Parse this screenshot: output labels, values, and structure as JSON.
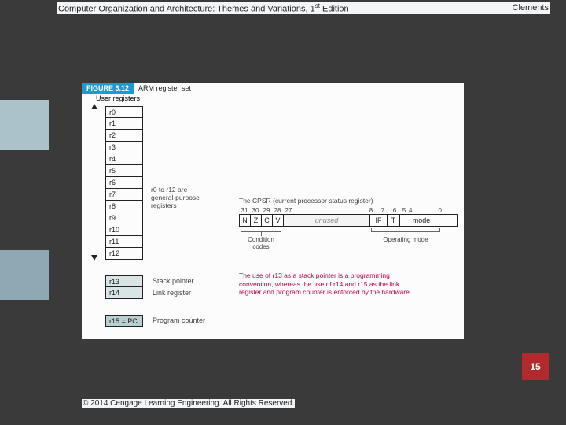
{
  "header": {
    "title_prefix": "Computer Organization and Architecture: Themes and Variations, 1",
    "title_suffix": " Edition",
    "sup": "st",
    "author": "Clements"
  },
  "figure": {
    "number": "FIGURE 3.12",
    "caption": "ARM register set",
    "reg_title": "User registers",
    "registers": [
      "r0",
      "r1",
      "r2",
      "r3",
      "r4",
      "r5",
      "r6",
      "r7",
      "r8",
      "r9",
      "r10",
      "r11",
      "r12",
      "r13",
      "r14",
      "r15 = PC"
    ],
    "gp_label_l1": "r0 to r12 are",
    "gp_label_l2": "general-purpose",
    "gp_label_l3": "registers",
    "sp_label": "Stack pointer",
    "lr_label": "Link register",
    "pc_label": "Program counter",
    "cpsr_title": "The CPSR (current processor status register)",
    "bits": [
      "31",
      "30",
      "29",
      "28",
      "27",
      "8",
      "7",
      "6",
      "5",
      "4",
      "0"
    ],
    "flags": [
      "N",
      "Z",
      "C",
      "V"
    ],
    "unused": "unused",
    "if": "IF",
    "t": "T",
    "mode": "mode",
    "cc_label": "Condition codes",
    "om_label": "Operating mode",
    "note_l1": "The use of r13 as a stack pointer is a programming",
    "note_l2": "convention, whereas the use of r14 and r15 as the link",
    "note_l3": "register and program counter is enforced by the hardware."
  },
  "page_number": "15",
  "copyright": "© 2014 Cengage Learning Engineering. All Rights Reserved."
}
